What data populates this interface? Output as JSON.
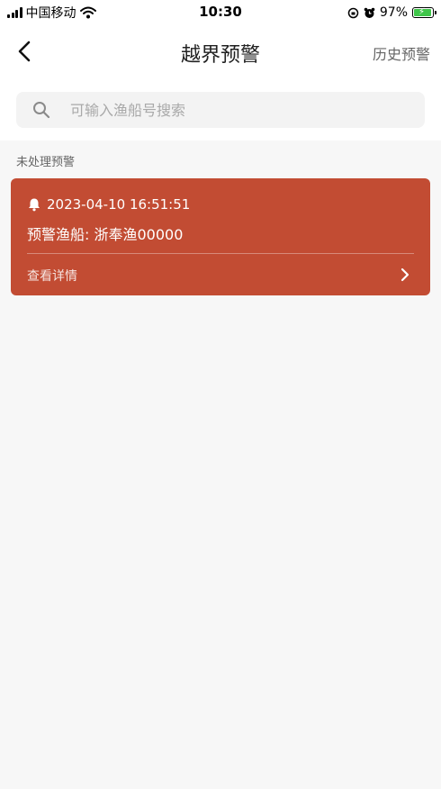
{
  "status_bar": {
    "carrier": "中国移动",
    "time": "10:30",
    "battery_percent": "97%",
    "icons": [
      "signal-icon",
      "wifi-icon",
      "rotation-lock-icon",
      "alarm-icon",
      "battery-charging-icon"
    ]
  },
  "nav": {
    "title": "越界预警",
    "history_label": "历史预警",
    "back_icon": "chevron-left-icon"
  },
  "search": {
    "placeholder": "可输入渔船号搜索",
    "value": "",
    "icon": "search-icon"
  },
  "section": {
    "label": "未处理预警"
  },
  "alerts": [
    {
      "icon": "bell-icon",
      "time": "2023-04-10 16:51:51",
      "vessel": "预警渔船: 浙奉渔00000",
      "detail_label": "查看详情",
      "detail_icon": "chevron-right-icon"
    }
  ],
  "colors": {
    "alert_card": "#c24c33",
    "page_background": "#f7f7f7",
    "battery_fill": "#3fc64a"
  }
}
